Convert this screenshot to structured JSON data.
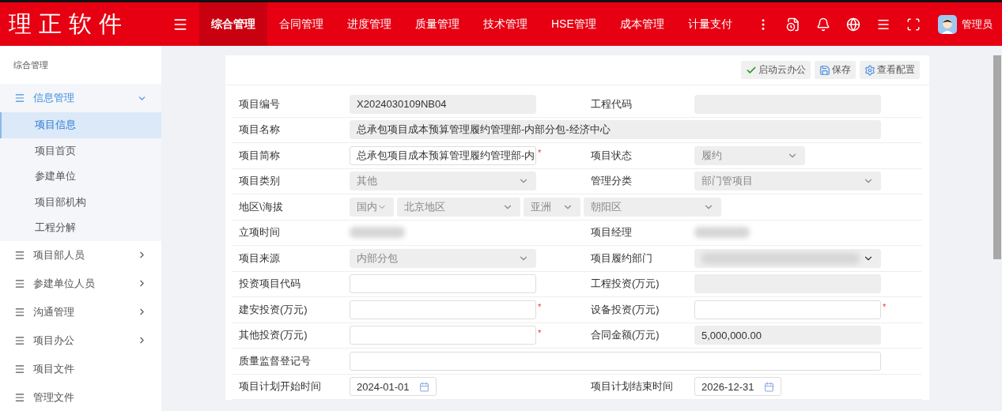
{
  "header": {
    "logo": "理正软件",
    "nav": [
      {
        "label": "综合管理",
        "selected": true
      },
      {
        "label": "合同管理",
        "selected": false
      },
      {
        "label": "进度管理",
        "selected": false
      },
      {
        "label": "质量管理",
        "selected": false
      },
      {
        "label": "技术管理",
        "selected": false
      },
      {
        "label": "HSE管理",
        "selected": false
      },
      {
        "label": "成本管理",
        "selected": false
      },
      {
        "label": "计量支付",
        "selected": false
      }
    ],
    "user": "管理员"
  },
  "sidebar": {
    "title": "综合管理",
    "groups": [
      {
        "label": "信息管理",
        "expanded": true,
        "has_children": true,
        "children": [
          {
            "label": "项目信息",
            "selected": true
          },
          {
            "label": "项目首页",
            "selected": false
          },
          {
            "label": "参建单位",
            "selected": false
          },
          {
            "label": "项目部机构",
            "selected": false
          },
          {
            "label": "工程分解",
            "selected": false
          }
        ]
      },
      {
        "label": "项目部人员",
        "expanded": false,
        "has_children": true
      },
      {
        "label": "参建单位人员",
        "expanded": false,
        "has_children": true
      },
      {
        "label": "沟通管理",
        "expanded": false,
        "has_children": true
      },
      {
        "label": "项目办公",
        "expanded": false,
        "has_children": true
      },
      {
        "label": "项目文件",
        "expanded": false,
        "has_children": false
      },
      {
        "label": "管理文件",
        "expanded": false,
        "has_children": false
      }
    ]
  },
  "toolbar": [
    {
      "kind": "check",
      "label": "启动云办公"
    },
    {
      "kind": "save",
      "label": "保存"
    },
    {
      "kind": "settings",
      "label": "查看配置"
    }
  ],
  "form": {
    "rows": [
      {
        "left": {
          "label": "项目编号",
          "kind": "readonly",
          "value": "X2024030109NB04"
        },
        "right": {
          "label": "工程代码",
          "kind": "readonly"
        }
      },
      {
        "left": {
          "label": "项目名称",
          "kind": "readonly-wide",
          "value": "总承包项目成本预算管理履约管理部-内部分包-经济中心"
        }
      },
      {
        "left": {
          "label": "项目简称",
          "kind": "input",
          "value": "总承包项目成本预算管理履约管理部-内",
          "required_mark": "*"
        },
        "right": {
          "label": "项目状态",
          "kind": "short-select",
          "value": "履约"
        }
      },
      {
        "left": {
          "label": "项目类别",
          "kind": "select",
          "value": "其他"
        },
        "right": {
          "label": "管理分类",
          "kind": "select",
          "value": "部门管项目"
        }
      },
      {
        "left": {
          "label": "地区\\海拔",
          "kind": "region",
          "parts": [
            "国内",
            "北京地区",
            "亚洲",
            "朝阳区"
          ]
        }
      },
      {
        "left": {
          "label": "立项时间",
          "kind": "blurred"
        },
        "right": {
          "label": "项目经理",
          "kind": "blurred"
        }
      },
      {
        "left": {
          "label": "项目来源",
          "kind": "select",
          "value": "内部分包"
        },
        "right": {
          "label": "项目履约部门",
          "kind": "blurred-select"
        }
      },
      {
        "left": {
          "label": "投资项目代码",
          "kind": "input"
        },
        "right": {
          "label": "工程投资(万元)",
          "kind": "readonly"
        }
      },
      {
        "left": {
          "label": "建安投资(万元)",
          "kind": "input",
          "required_mark": "*"
        },
        "right": {
          "label": "设备投资(万元)",
          "kind": "input",
          "required_mark": "*"
        }
      },
      {
        "left": {
          "label": "其他投资(万元)",
          "kind": "input",
          "required_mark": "*"
        },
        "right": {
          "label": "合同金额(万元)",
          "kind": "readonly",
          "value": "5,000,000.00"
        }
      },
      {
        "left": {
          "label": "质量监督登记号",
          "kind": "input-wide"
        }
      },
      {
        "left": {
          "label": "项目计划开始时间",
          "kind": "date",
          "value": "2024-01-01"
        },
        "right": {
          "label": "项目计划结束时间",
          "kind": "date",
          "value": "2026-12-31"
        }
      }
    ]
  }
}
